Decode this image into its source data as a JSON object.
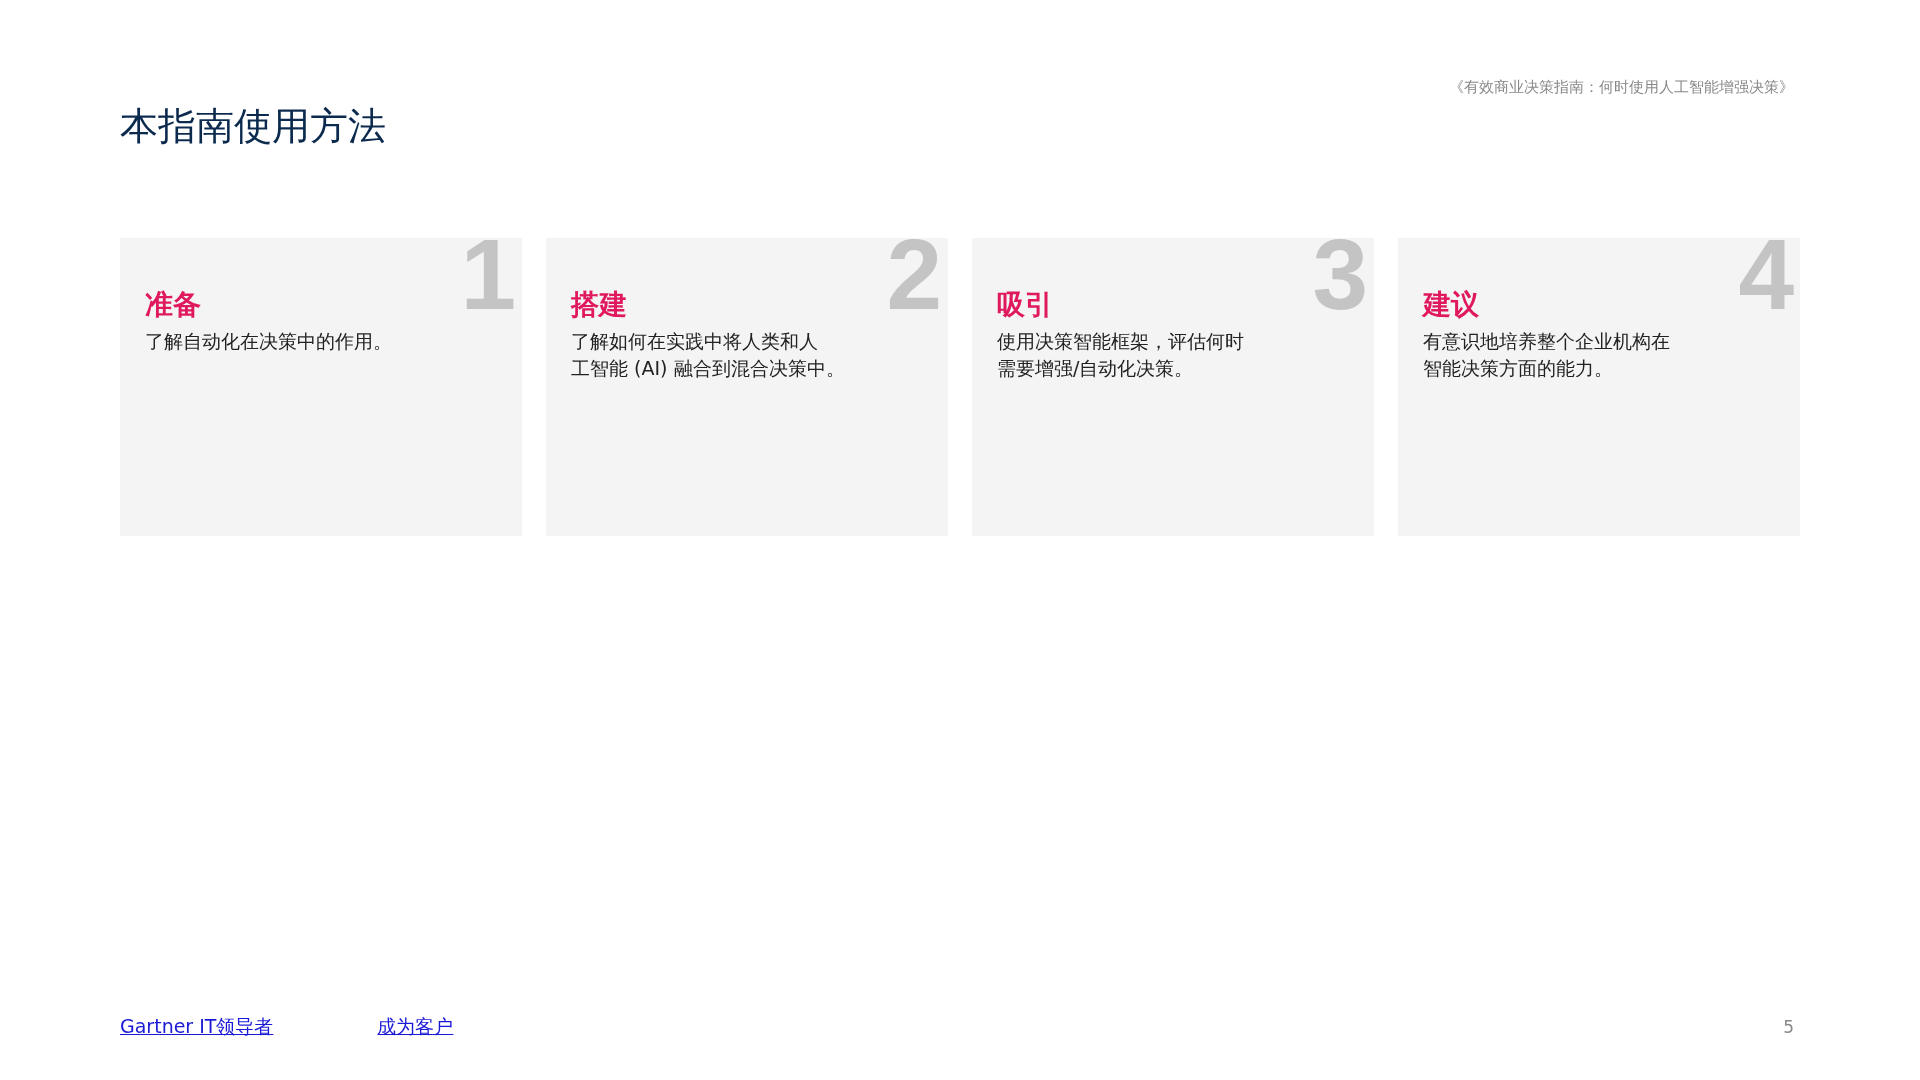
{
  "header": {
    "document_title": "《有效商业决策指南：何时使用人工智能增强决策》"
  },
  "title": "本指南使用方法",
  "cards": [
    {
      "number": "1",
      "heading": "准备",
      "lines": [
        "了解自动化在决策中的作用。"
      ]
    },
    {
      "number": "2",
      "heading": "搭建",
      "lines": [
        "了解如何在实践中将人类和人",
        "工智能 (AI) 融合到混合决策中。"
      ]
    },
    {
      "number": "3",
      "heading": "吸引",
      "lines": [
        "使用决策智能框架，评估何时",
        "需要增强/自动化决策。"
      ]
    },
    {
      "number": "4",
      "heading": "建议",
      "lines": [
        "有意识地培养整个企业机构在",
        "智能决策方面的能力。"
      ]
    }
  ],
  "footer": {
    "links": [
      "Gartner IT领导者",
      "成为客户"
    ],
    "page_number": "5"
  }
}
